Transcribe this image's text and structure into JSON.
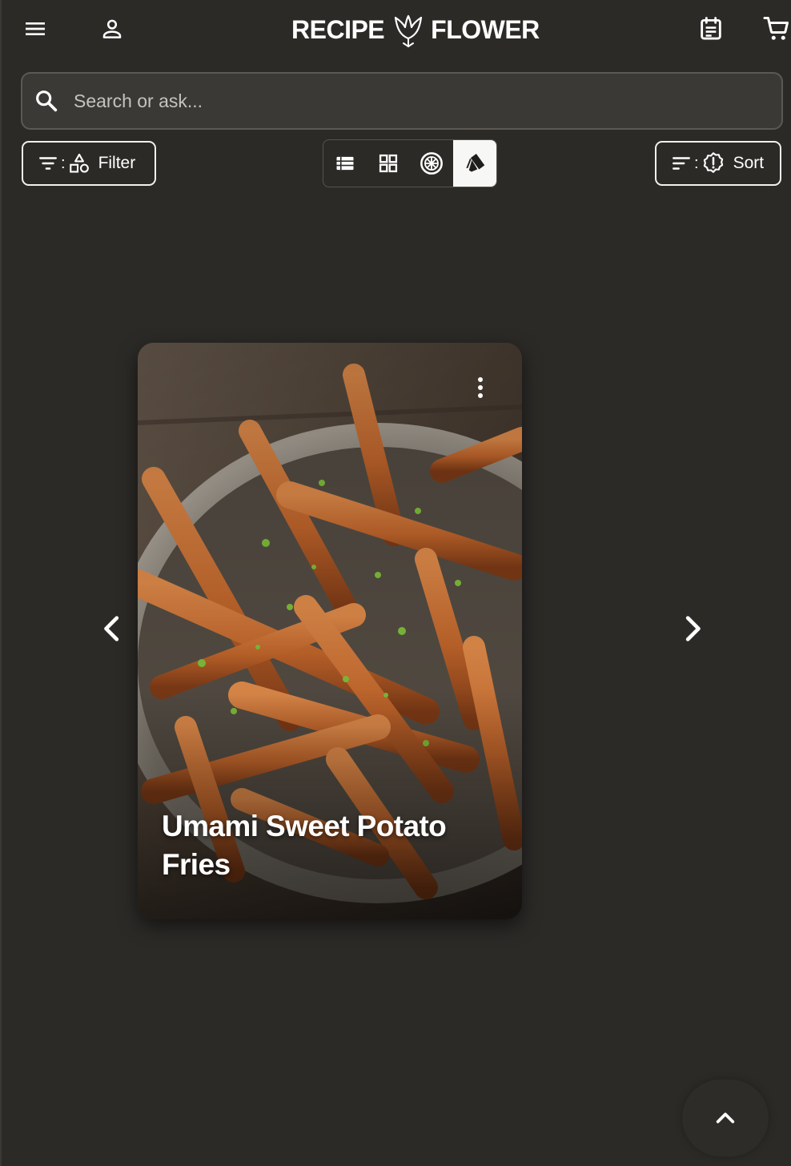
{
  "app": {
    "logo_left": "RECIPE",
    "logo_right": "FLOWER"
  },
  "header": {
    "menu_icon": "menu-icon",
    "account_icon": "account-icon",
    "planner_icon": "meal-planner-icon",
    "cart_icon": "shopping-cart-icon"
  },
  "search": {
    "placeholder": "Search or ask...",
    "value": ""
  },
  "toolbar": {
    "filter_label": "Filter",
    "filter_separator": ":",
    "sort_label": "Sort",
    "sort_separator": ":",
    "views": [
      {
        "name": "list-view",
        "active": false
      },
      {
        "name": "grid-view",
        "active": false
      },
      {
        "name": "wheel-view",
        "active": false
      },
      {
        "name": "card-stack-view",
        "active": true
      }
    ]
  },
  "carousel": {
    "current_card": {
      "title": "Umami Sweet Potato Fries"
    }
  },
  "colors": {
    "background": "#2b2a27",
    "foreground": "#ffffff",
    "search_bg": "#3a3936",
    "active_view_bg": "#f7f7f5"
  }
}
